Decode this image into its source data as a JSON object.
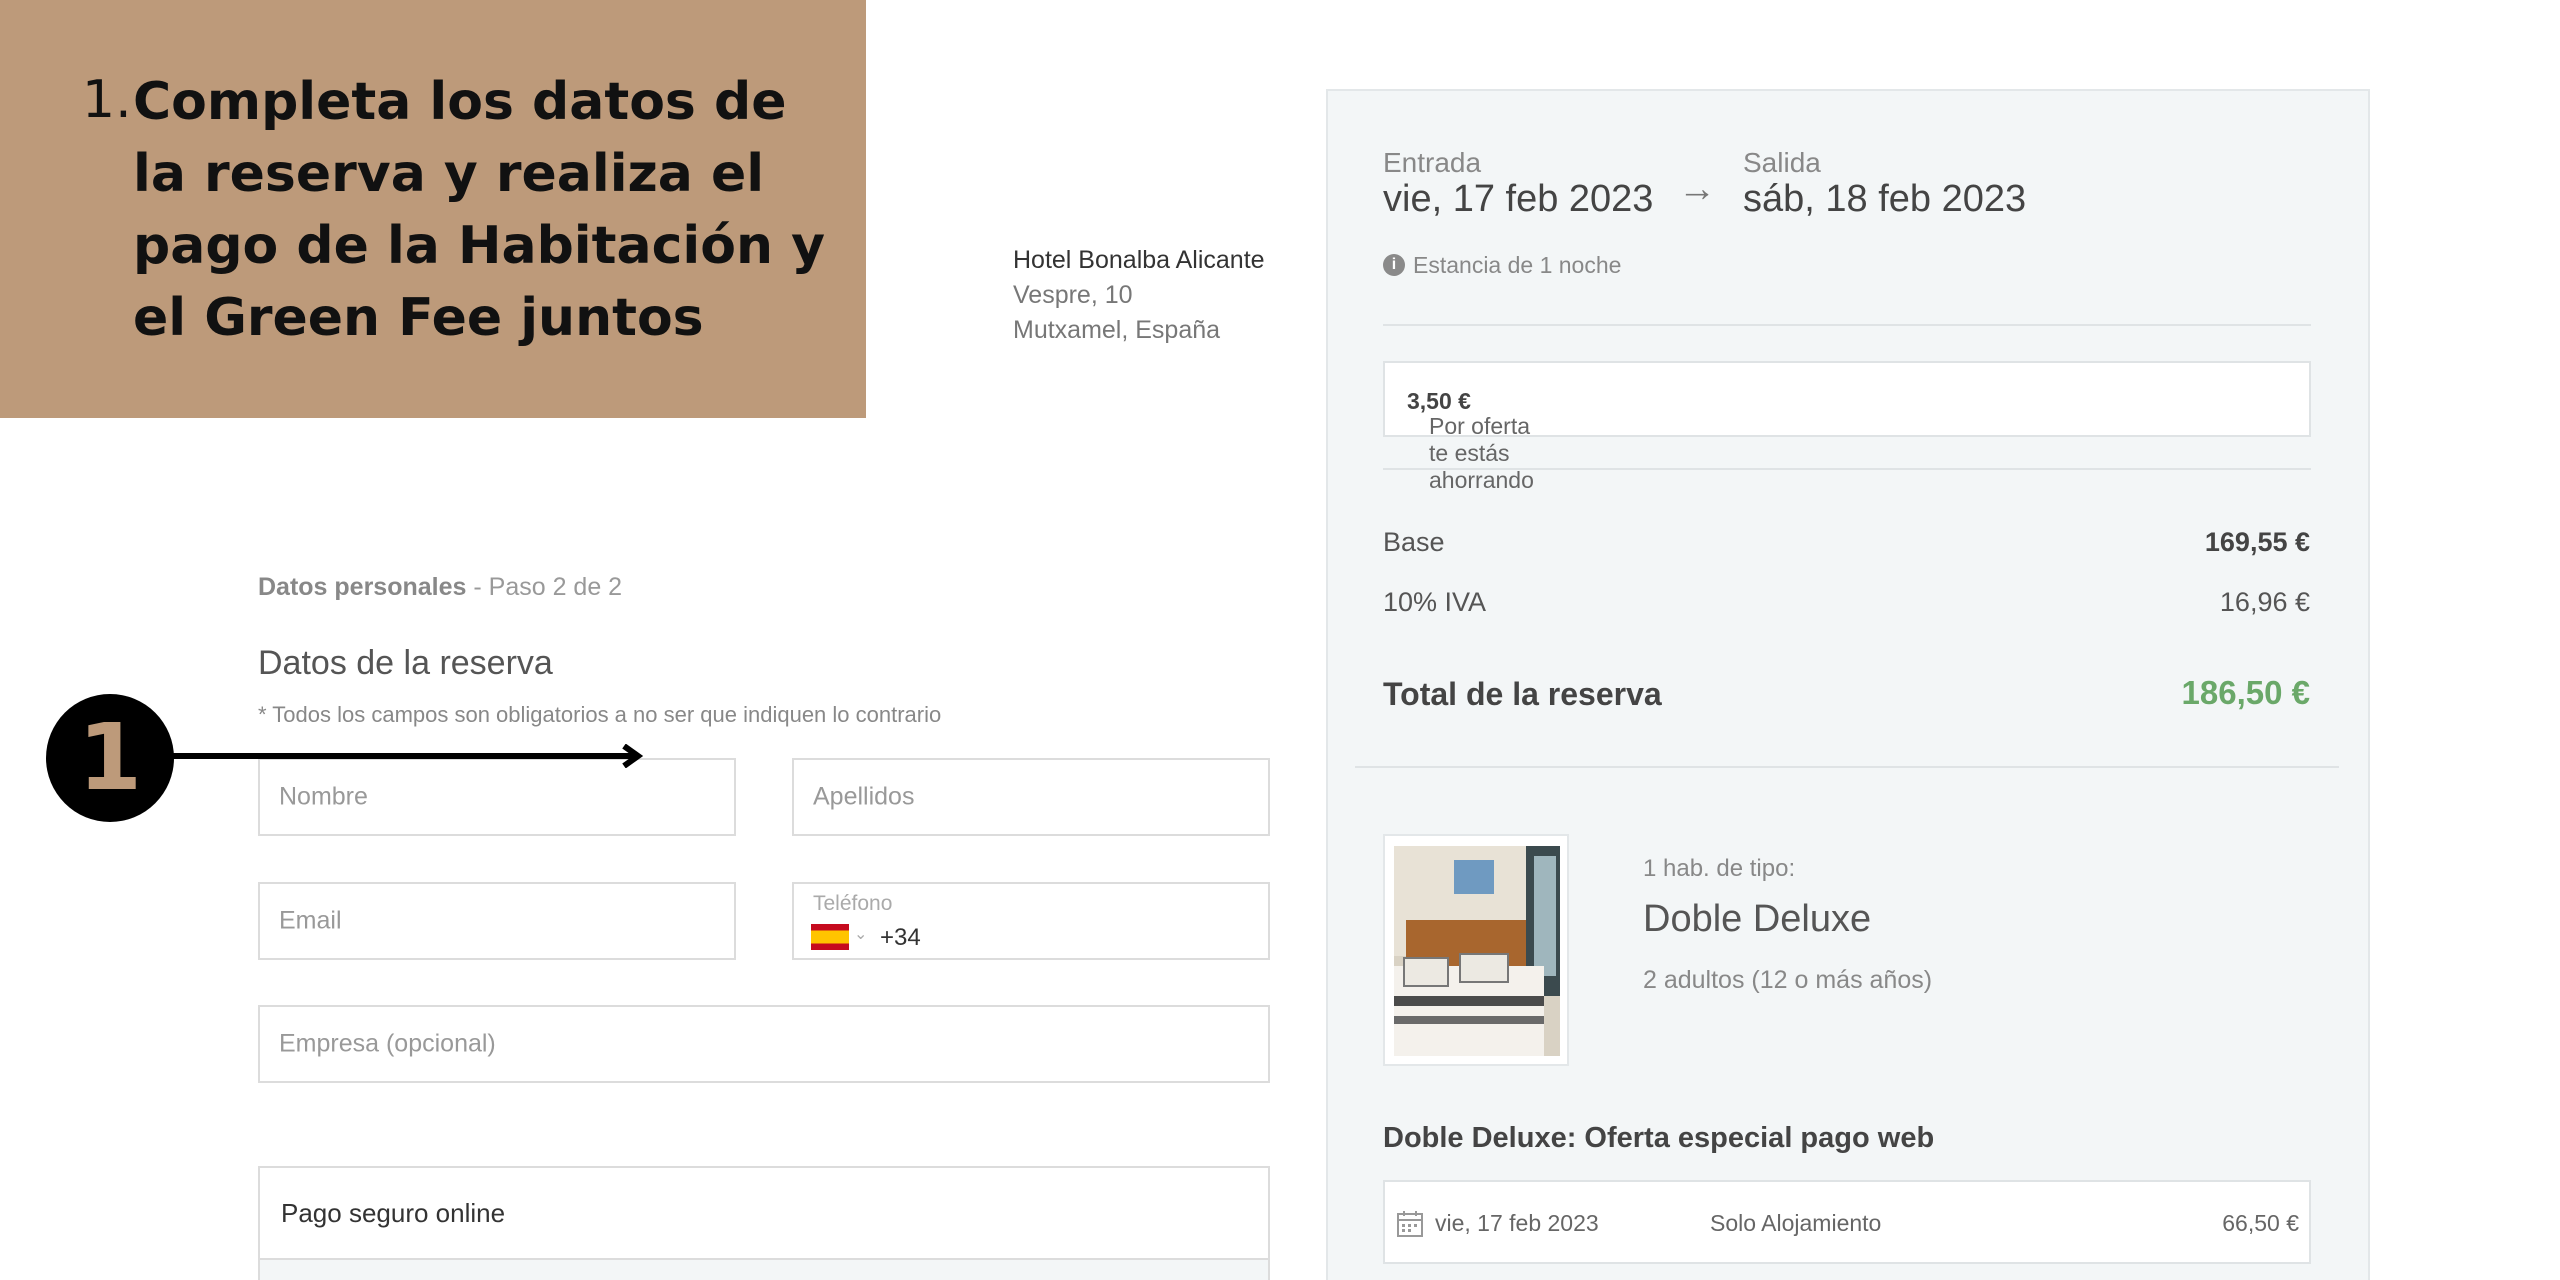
{
  "instruction": {
    "number": "1.",
    "text": "Completa los datos de la reserva y realiza el pago de la Habitación y el Green Fee juntos"
  },
  "hotel": {
    "name": "Hotel Bonalba Alicante",
    "street": "Vespre, 10",
    "city": "Mutxamel, España"
  },
  "form": {
    "step_bold": "Datos personales",
    "step_rest": " - Paso 2 de 2",
    "title": "Datos de la reserva",
    "note": "* Todos los campos son obligatorios a no ser que indiquen lo contrario",
    "nombre_placeholder": "Nombre",
    "apellidos_placeholder": "Apellidos",
    "email_placeholder": "Email",
    "telefono_label": "Teléfono",
    "telefono_prefix": "+34",
    "empresa_placeholder": "Empresa (opcional)",
    "pago_title": "Pago seguro online"
  },
  "badge": {
    "number": "1"
  },
  "summary": {
    "entrada_label": "Entrada",
    "entrada_value": "vie, 17 feb 2023",
    "salida_label": "Salida",
    "salida_value": "sáb, 18 feb 2023",
    "estancia": "Estancia de 1 noche",
    "offer_text": "Por oferta te estás ahorrando ",
    "offer_amount": "3,50 €",
    "base_label": "Base",
    "base_value": "169,55 €",
    "iva_label": "10% IVA",
    "iva_value": "16,96 €",
    "total_label": "Total de la reserva",
    "total_value": "186,50 €",
    "room_type_label": "1 hab. de tipo:",
    "room_name": "Doble Deluxe",
    "room_guests": "2 adultos (12 o más años)",
    "rate_title": "Doble Deluxe: Oferta especial pago web",
    "night_date": "vie, 17 feb 2023",
    "night_regime": "Solo Alojamiento",
    "night_price": "66,50 €"
  },
  "colors": {
    "banner": "#bd9a7a",
    "total": "#6aa869",
    "panel": "#f3f6f7"
  }
}
